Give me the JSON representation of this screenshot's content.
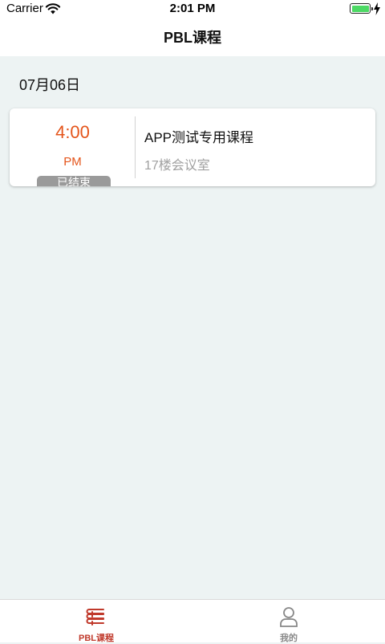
{
  "status_bar": {
    "carrier": "Carrier",
    "time": "2:01 PM",
    "icons": [
      "wifi-icon",
      "battery-icon",
      "charging-bolt-icon"
    ]
  },
  "nav": {
    "title": "PBL课程"
  },
  "date_header": "07月06日",
  "course_card": {
    "time": "4:00",
    "ampm": "PM",
    "status_badge": "已结束",
    "title": "APP测试专用课程",
    "location": "17楼会议室"
  },
  "tab_bar": {
    "items": [
      {
        "label": "PBL课程",
        "icon": "books-icon",
        "active": true
      },
      {
        "label": "我的",
        "icon": "person-icon",
        "active": false
      }
    ]
  },
  "colors": {
    "accent_orange": "#e4541a",
    "tab_active": "#c0392b",
    "badge_gray": "#9a9a9a",
    "background": "#edf3f3",
    "battery_green": "#4cd964"
  }
}
